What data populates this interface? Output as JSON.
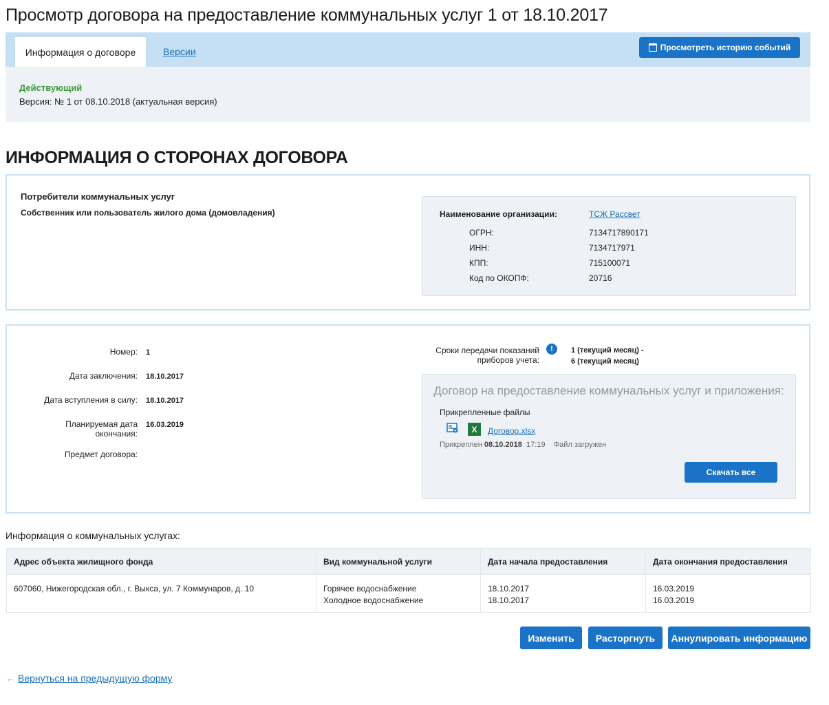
{
  "page_title": "Просмотр договора на предоставление коммунальных услуг 1 от 18.10.2017",
  "tabs": {
    "active": "Информация о договоре",
    "versions": "Версии",
    "history_button": "Просмотреть историю событий"
  },
  "status": {
    "state": "Действующий",
    "version": "Версия: № 1 от 08.10.2018 (актуальная версия)"
  },
  "parties_section_title": "ИНФОРМАЦИЯ О СТОРОНАХ ДОГОВОРА",
  "consumers": {
    "title": "Потребители коммунальных услуг",
    "subtitle": "Собственник или пользователь жилого дома (домовладения)"
  },
  "organization": {
    "name_label": "Наименование организации:",
    "name": "ТСЖ Рассвет",
    "ogrn_label": "ОГРН:",
    "ogrn": "7134717890171",
    "inn_label": "ИНН:",
    "inn": "7134717971",
    "kpp_label": "КПП:",
    "kpp": "715100071",
    "okopf_label": "Код по ОКОПФ:",
    "okopf": "20716"
  },
  "contract": {
    "number_label": "Номер:",
    "number": "1",
    "date_label": "Дата заключения:",
    "date": "18.10.2017",
    "effective_label": "Дата вступления в силу:",
    "effective": "18.10.2017",
    "planned_end_label_1": "Планируемая дата",
    "planned_end_label_2": "окончания:",
    "planned_end": "16.03.2019",
    "subject_label": "Предмет договора:",
    "deadline_label_1": "Сроки передачи показаний",
    "deadline_label_2": "приборов учета:",
    "deadline_1": "1 (текущий месяц) -",
    "deadline_2": "6 (текущий месяц)",
    "info_icon_glyph": "!"
  },
  "files": {
    "title": "Договор на предоставление коммунальных услуг и приложения:",
    "subtitle": "Прикрепленные файлы",
    "file_name": "Договор.xlsx",
    "attached_prefix": "Прикреплен",
    "attached_date": "08.10.2018",
    "attached_time": "17:19",
    "file_status": "Файл загружен",
    "download_all": "Скачать все",
    "xls_glyph": "X"
  },
  "services": {
    "title": "Информация о коммунальных услугах:",
    "headers": [
      "Адрес объекта жилищного фонда",
      "Вид коммунальной услуги",
      "Дата начала предоставления",
      "Дата окончания предоставления"
    ],
    "row": {
      "address": "607060, Нижегородская обл., г. Выкса, ул. 7 Коммунаров, д. 10",
      "service_1": "Горячее водоснабжение",
      "service_2": "Холодное водоснабжение",
      "start_1": "18.10.2017",
      "start_2": "18.10.2017",
      "end_1": "16.03.2019",
      "end_2": "16.03.2019"
    }
  },
  "actions": {
    "change": "Изменить",
    "terminate": "Расторгнуть",
    "annul": "Аннулировать информацию"
  },
  "back_link": {
    "arrow": "←",
    "text": "Вернуться на предыдущую форму"
  },
  "colors": {
    "accent": "#1a73c7",
    "status_green": "#3a9a3a",
    "tabbar": "#c5dff5",
    "panel": "#eef2f6"
  }
}
